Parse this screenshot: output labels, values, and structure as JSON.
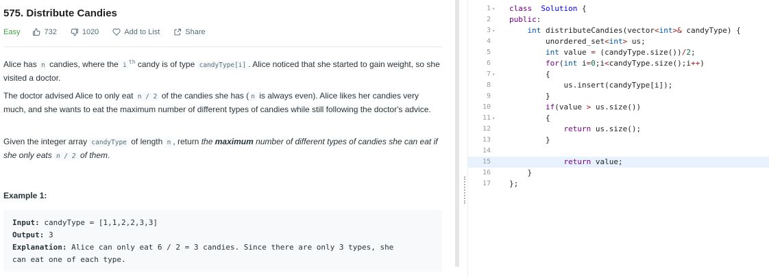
{
  "problem": {
    "title": "575. Distribute Candies",
    "difficulty": "Easy",
    "likes": "732",
    "dislikes": "1020",
    "add_to_list": "Add to List",
    "share": "Share"
  },
  "description": {
    "p1": [
      "Alice has ",
      "n",
      " candies, where the ",
      "i",
      "th",
      " candy is of type ",
      "candyType[i]",
      ". Alice noticed that she started to gain weight, so she visited a doctor."
    ],
    "p2": [
      "The doctor advised Alice to only eat ",
      "n / 2",
      " of the candies she has (",
      "n",
      " is always even). Alice likes her candies very much, and she wants to eat the maximum number of different types of candies while still following the doctor's advice."
    ],
    "p3": [
      "Given the integer array ",
      "candyType",
      " of length ",
      "n",
      ", return ",
      "the ",
      "maximum",
      " number of different types of candies she can eat if she only eats ",
      "n / 2",
      " of them",
      "."
    ]
  },
  "example": {
    "title": "Example 1:",
    "input_label": "Input:",
    "input_value": " candyType = [1,1,2,2,3,3]",
    "output_label": "Output:",
    "output_value": " 3",
    "explanation_label": "Explanation:",
    "explanation_line1": " Alice can only eat 6 / 2 = 3 candies. Since there are only 3 types, she",
    "explanation_line2": "can eat one of each type."
  },
  "editor": {
    "active_line": 15,
    "lines": [
      {
        "n": "1",
        "fold": true
      },
      {
        "n": "2",
        "fold": false
      },
      {
        "n": "3",
        "fold": true
      },
      {
        "n": "4",
        "fold": false
      },
      {
        "n": "5",
        "fold": false
      },
      {
        "n": "6",
        "fold": false
      },
      {
        "n": "7",
        "fold": true
      },
      {
        "n": "8",
        "fold": false
      },
      {
        "n": "9",
        "fold": false
      },
      {
        "n": "10",
        "fold": false
      },
      {
        "n": "11",
        "fold": true
      },
      {
        "n": "12",
        "fold": false
      },
      {
        "n": "13",
        "fold": false
      },
      {
        "n": "14",
        "fold": false
      },
      {
        "n": "15",
        "fold": false
      },
      {
        "n": "16",
        "fold": false
      },
      {
        "n": "17",
        "fold": false
      }
    ],
    "code": [
      [
        [
          "kw",
          "class"
        ],
        [
          "",
          "  "
        ],
        [
          "df",
          "Solution"
        ],
        [
          "",
          " {"
        ]
      ],
      [
        [
          "kw",
          "public"
        ],
        [
          "",
          ":"
        ]
      ],
      [
        [
          "",
          "    "
        ],
        [
          "ty",
          "int"
        ],
        [
          "",
          " distributeCandies(vector"
        ],
        [
          "op",
          "<"
        ],
        [
          "ty",
          "int"
        ],
        [
          "op",
          ">&"
        ],
        [
          "",
          " candyType) {"
        ]
      ],
      [
        [
          "",
          "        unordered_set"
        ],
        [
          "op",
          "<"
        ],
        [
          "ty",
          "int"
        ],
        [
          "op",
          ">"
        ],
        [
          "",
          " us;"
        ]
      ],
      [
        [
          "",
          "        "
        ],
        [
          "ty",
          "int"
        ],
        [
          "",
          " value "
        ],
        [
          "op",
          "="
        ],
        [
          "",
          " (candyType.size())"
        ],
        [
          "op",
          "/"
        ],
        [
          "nm",
          "2"
        ],
        [
          "",
          ";"
        ]
      ],
      [
        [
          "",
          "        "
        ],
        [
          "kw",
          "for"
        ],
        [
          "",
          "("
        ],
        [
          "ty",
          "int"
        ],
        [
          "",
          " i"
        ],
        [
          "op",
          "="
        ],
        [
          "nm",
          "0"
        ],
        [
          "",
          ";i"
        ],
        [
          "op",
          "<"
        ],
        [
          "",
          "candyType.size();i"
        ],
        [
          "op",
          "++"
        ],
        [
          "",
          ")"
        ]
      ],
      [
        [
          "",
          "        {"
        ]
      ],
      [
        [
          "",
          "            us.insert(candyType[i]);"
        ]
      ],
      [
        [
          "",
          "        }"
        ]
      ],
      [
        [
          "",
          "        "
        ],
        [
          "kw",
          "if"
        ],
        [
          "",
          "(value "
        ],
        [
          "op",
          ">"
        ],
        [
          "",
          " us.size())"
        ]
      ],
      [
        [
          "",
          "        {"
        ]
      ],
      [
        [
          "",
          "            "
        ],
        [
          "kw",
          "return"
        ],
        [
          "",
          " us.size();"
        ]
      ],
      [
        [
          "",
          "        }"
        ]
      ],
      [
        [
          "",
          ""
        ]
      ],
      [
        [
          "",
          "            "
        ],
        [
          "kw",
          "return"
        ],
        [
          "",
          " value;"
        ]
      ],
      [
        [
          "",
          "    }"
        ]
      ],
      [
        [
          "",
          "};"
        ]
      ]
    ]
  }
}
